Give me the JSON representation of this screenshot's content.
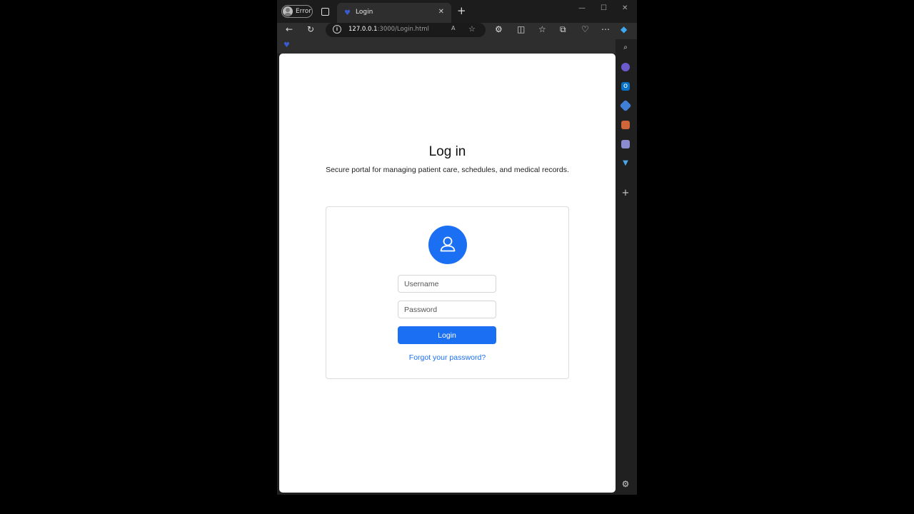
{
  "browser": {
    "profile_label": "Error",
    "tab_title": "Login",
    "url_host": "127.0.0.1",
    "url_path": ":3000/Login.html"
  },
  "page": {
    "title": "Log in",
    "subtitle": "Secure portal for managing patient care, schedules, and medical records."
  },
  "form": {
    "username_placeholder": "Username",
    "password_placeholder": "Password",
    "login_label": "Login",
    "forgot_label": "Forgot your password?"
  },
  "colors": {
    "primary": "#1a6ff2",
    "browser_chrome": "#2e2e2e"
  },
  "icons": {
    "avatar": "user-icon"
  }
}
